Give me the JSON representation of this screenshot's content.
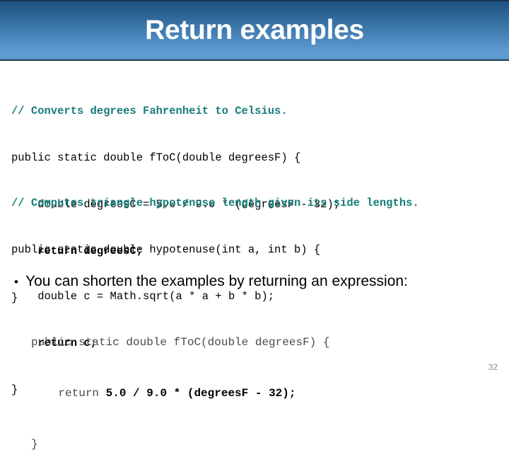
{
  "slide": {
    "title": "Return examples",
    "page_number": "32",
    "banner_gradient_top": "#1d4f7c",
    "banner_gradient_bottom": "#5b99ce",
    "comment_color": "#157d7a",
    "background_color": "#ffffff"
  },
  "code_block_1": {
    "comment": "// Converts degrees Fahrenheit to Celsius.",
    "line_signature": "public static double fToC(double degreesF) {",
    "line_declaration": "    double degreesC = 5.0 / 9.0 * (degreesF - 32);",
    "line_return": "    return degreesC;",
    "line_close": "}"
  },
  "code_block_2": {
    "comment": "// Computes triangle hypotenuse length given its side lengths.",
    "line_signature": "public static double hypotenuse(int a, int b) {",
    "line_declaration": "    double c = Math.sqrt(a * a + b * b);",
    "line_return": "    return c;",
    "line_close": "}"
  },
  "bullet": {
    "marker": "•",
    "text": "You can shorten the examples by returning an expression:"
  },
  "code_block_3": {
    "line_signature": "public static double fToC(double degreesF) {",
    "line_return_keyword": "    return ",
    "line_return_expression": "5.0 / 9.0 * (degreesF - 32);",
    "line_close": "}"
  }
}
